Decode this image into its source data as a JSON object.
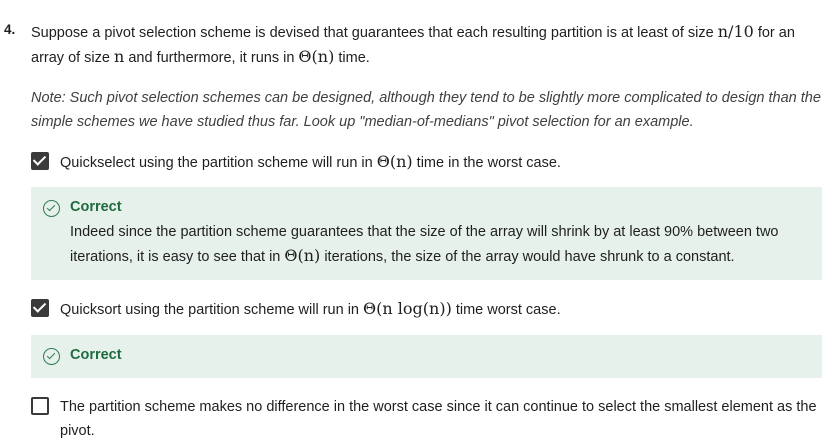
{
  "question": {
    "number": "4.",
    "text_a": "Suppose a pivot selection scheme is devised that guarantees that each resulting partition is at least of size",
    "math_a": "n/10",
    "text_b": "for an array of size",
    "math_b": "n",
    "text_c": "and furthermore, it runs in",
    "math_c": "Θ(n)",
    "text_d": "time.",
    "note": "Note: Such pivot selection schemes can be designed, although they tend to be slightly more complicated to design than the simple schemes we have studied thus far. Look up \"median-of-medians\" pivot selection for an example."
  },
  "options": [
    {
      "checked": true,
      "text_a": "Quickselect using the partition scheme will run in",
      "math": "Θ(n)",
      "text_b": "time in the worst case.",
      "feedback": {
        "title": "Correct",
        "text_a": "Indeed since the partition scheme guarantees that the size of the array will shrink by at least 90% between two iterations, it is easy to see that in",
        "math": "Θ(n)",
        "text_b": "iterations, the size of the array would have shrunk to a constant."
      }
    },
    {
      "checked": true,
      "text_a": "Quicksort using the partition scheme will run in",
      "math": "Θ(n log(n))",
      "text_b": "time worst case.",
      "feedback": {
        "title": "Correct"
      }
    },
    {
      "checked": false,
      "text": "The partition scheme makes no difference in the worst case since it can continue to select the smallest element as the pivot."
    }
  ],
  "colors": {
    "feedback_bg": "#e7f1ec",
    "correct_green": "#1f6b3f",
    "checkbox": "#3a3a3a"
  }
}
